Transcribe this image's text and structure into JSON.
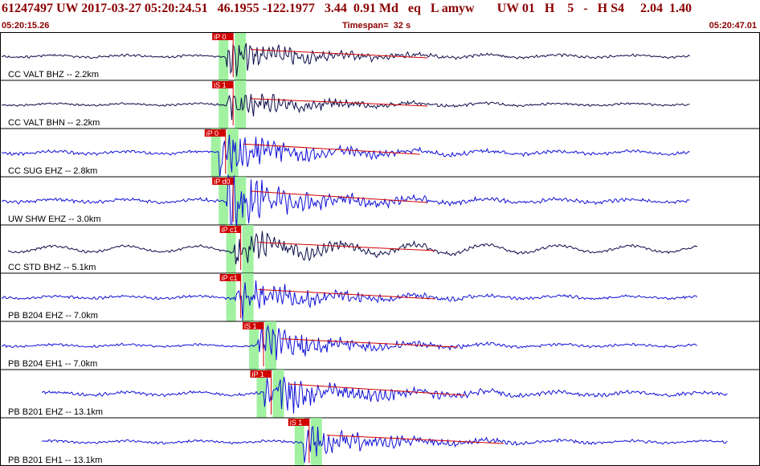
{
  "header": {
    "line": "61247497 UW 2017-03-27 05:20:24.51   46.1955 -122.1977   3.44  0.91 Md   eq   L amyw       UW 01   H    5   -   H S4     2.04  1.40",
    "start_time": "05:20:15.26",
    "timespan": "Timespan=  32 s",
    "end_time": "05:20:47.01"
  },
  "colors": {
    "trace_black": "#0b0b4a",
    "trace_blue": "#1010d8",
    "pick": "#d00000",
    "window": "#90ee90",
    "header_text": "#8b0000"
  },
  "chart_data": {
    "type": "line",
    "title": "",
    "x_range": [
      "05:20:15.26",
      "05:20:47.01"
    ],
    "traces": [
      {
        "label": "CC VALT BHZ -- 2.2km",
        "pick_label": "iP 0",
        "color": "black",
        "amp": 0.35,
        "arrival": 0.33,
        "tail": 0.95
      },
      {
        "label": "CC VALT BHN -- 2.2km",
        "pick_label": "iS 1",
        "color": "black",
        "amp": 0.3,
        "arrival": 0.33,
        "tail": 0.95
      },
      {
        "label": "CC SUG EHZ -- 2.8km",
        "pick_label": "iP 0",
        "color": "blue",
        "amp": 0.45,
        "arrival": 0.32,
        "tail": 0.95
      },
      {
        "label": "UW SHW EHZ -- 3.0km",
        "pick_label": "iP d0",
        "color": "blue",
        "amp": 0.5,
        "arrival": 0.33,
        "tail": 0.95
      },
      {
        "label": "CC STD BHZ -- 5.1km",
        "pick_label": "iP c1",
        "color": "black",
        "amp": 0.35,
        "arrival": 0.34,
        "tail": 0.96
      },
      {
        "label": "PB B204 EHZ -- 7.0km",
        "pick_label": "iP c1",
        "color": "blue",
        "amp": 0.4,
        "arrival": 0.34,
        "tail": 0.96
      },
      {
        "label": "PB B204 EH1 -- 7.0km",
        "pick_label": "iS 1",
        "color": "blue",
        "amp": 0.35,
        "arrival": 0.37,
        "tail": 0.96
      },
      {
        "label": "PB B201 EHZ -- 13.1km",
        "pick_label": "iP 1",
        "color": "blue",
        "amp": 0.5,
        "arrival": 0.38,
        "tail": 1.0
      },
      {
        "label": "PB B201 EH1 -- 13.1km",
        "pick_label": "iS 1",
        "color": "blue",
        "amp": 0.35,
        "arrival": 0.43,
        "tail": 1.0
      }
    ]
  }
}
